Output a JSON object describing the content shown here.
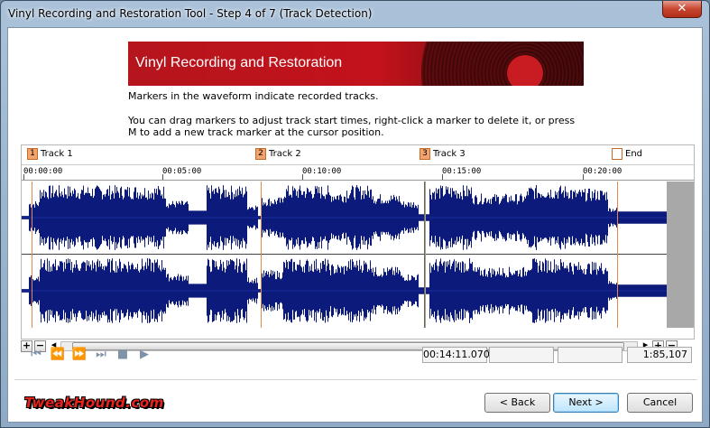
{
  "window": {
    "title": "Vinyl Recording and Restoration Tool - Step 4 of 7 (Track Detection)",
    "close_glyph": "✕"
  },
  "banner": {
    "title": "Vinyl Recording and Restoration"
  },
  "instructions": {
    "line1": "Markers in the waveform indicate recorded tracks.",
    "line2": "You can drag markers to adjust track start times, right-click a marker to delete it, or press M to add a new track marker at the cursor position."
  },
  "markers": [
    {
      "num": "1",
      "label": "Track 1"
    },
    {
      "num": "2",
      "label": "Track 2"
    },
    {
      "num": "3",
      "label": "Track 3"
    },
    {
      "num": "",
      "label": "End"
    }
  ],
  "ruler": [
    "00:00:00",
    "00:05:00",
    "00:10:00",
    "00:15:00",
    "00:20:00"
  ],
  "scroll": {
    "plus": "+",
    "minus": "−",
    "left": "◂",
    "right": "▸"
  },
  "transport": {
    "skip_start": "⏮",
    "prev": "⏪",
    "next": "⏩",
    "skip_end": "⏭",
    "stop": "■",
    "play": "▶"
  },
  "status": {
    "position": "00:14:11.070",
    "field2": "",
    "field3": "",
    "zoom": "1:85,107"
  },
  "buttons": {
    "back": "< Back",
    "next": "Next >",
    "cancel": "Cancel"
  },
  "logo": {
    "text": "TweakHound.com"
  },
  "colors": {
    "waveform": "#0c1a7c",
    "marker": "#f3a36b",
    "banner": "#c3121b"
  }
}
